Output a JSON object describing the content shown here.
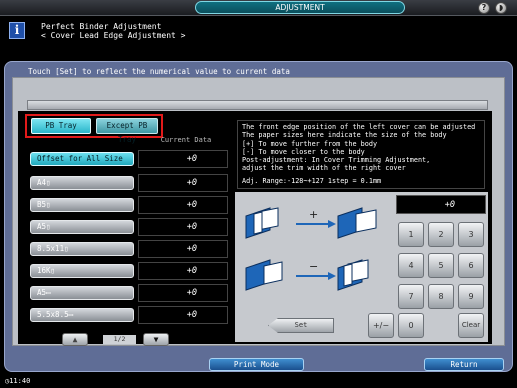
{
  "window": {
    "title": "ADJUSTMENT"
  },
  "header": {
    "title_line1": "Perfect Binder Adjustment",
    "title_line2": "< Cover Lead Edge Adjustment >"
  },
  "instruction": "Touch [Set] to reflect the numerical value to current data",
  "tray_tabs": {
    "pb": "PB Tray",
    "except": "Except PB Tray"
  },
  "current_data_label": "Current Data",
  "sizes": [
    {
      "label": "Offset for All Size",
      "value": "+0"
    },
    {
      "label": "A4▯",
      "value": "+0"
    },
    {
      "label": "B5▯",
      "value": "+0"
    },
    {
      "label": "A5▯",
      "value": "+0"
    },
    {
      "label": "8.5x11▯",
      "value": "+0"
    },
    {
      "label": "16K▯",
      "value": "+0"
    },
    {
      "label": "A5▭",
      "value": "+0"
    },
    {
      "label": "5.5x8.5▭",
      "value": "+0"
    }
  ],
  "pager": {
    "indicator": "1/2"
  },
  "description": {
    "line1": "The front edge position of the left cover can be adjusted",
    "line2": "The paper sizes here indicate the size of the body",
    "line3": "[+] To move further from the body",
    "line4": "[-] To move closer to the body",
    "line5": "Post-adjustment: In Cover Trimming Adjustment,",
    "line6": "adjust the trim width of the right cover",
    "line7": "Adj. Range:-128~+127 1step = 0.1mm"
  },
  "diagram": {
    "plus": "+",
    "minus": "−"
  },
  "input_value": "+0",
  "keypad": {
    "k1": "1",
    "k2": "2",
    "k3": "3",
    "k4": "4",
    "k5": "5",
    "k6": "6",
    "k7": "7",
    "k8": "8",
    "k9": "9",
    "k0": "0",
    "plusminus": "+/−",
    "clear": "Clear"
  },
  "set_label": "Set",
  "footer": {
    "print_mode": "Print Mode",
    "return": "Return"
  },
  "status": {
    "time": "11:40"
  },
  "colors": {
    "accent": "#20a9bd",
    "panel": "#5f6d96",
    "highlight": "#e21a1a"
  }
}
